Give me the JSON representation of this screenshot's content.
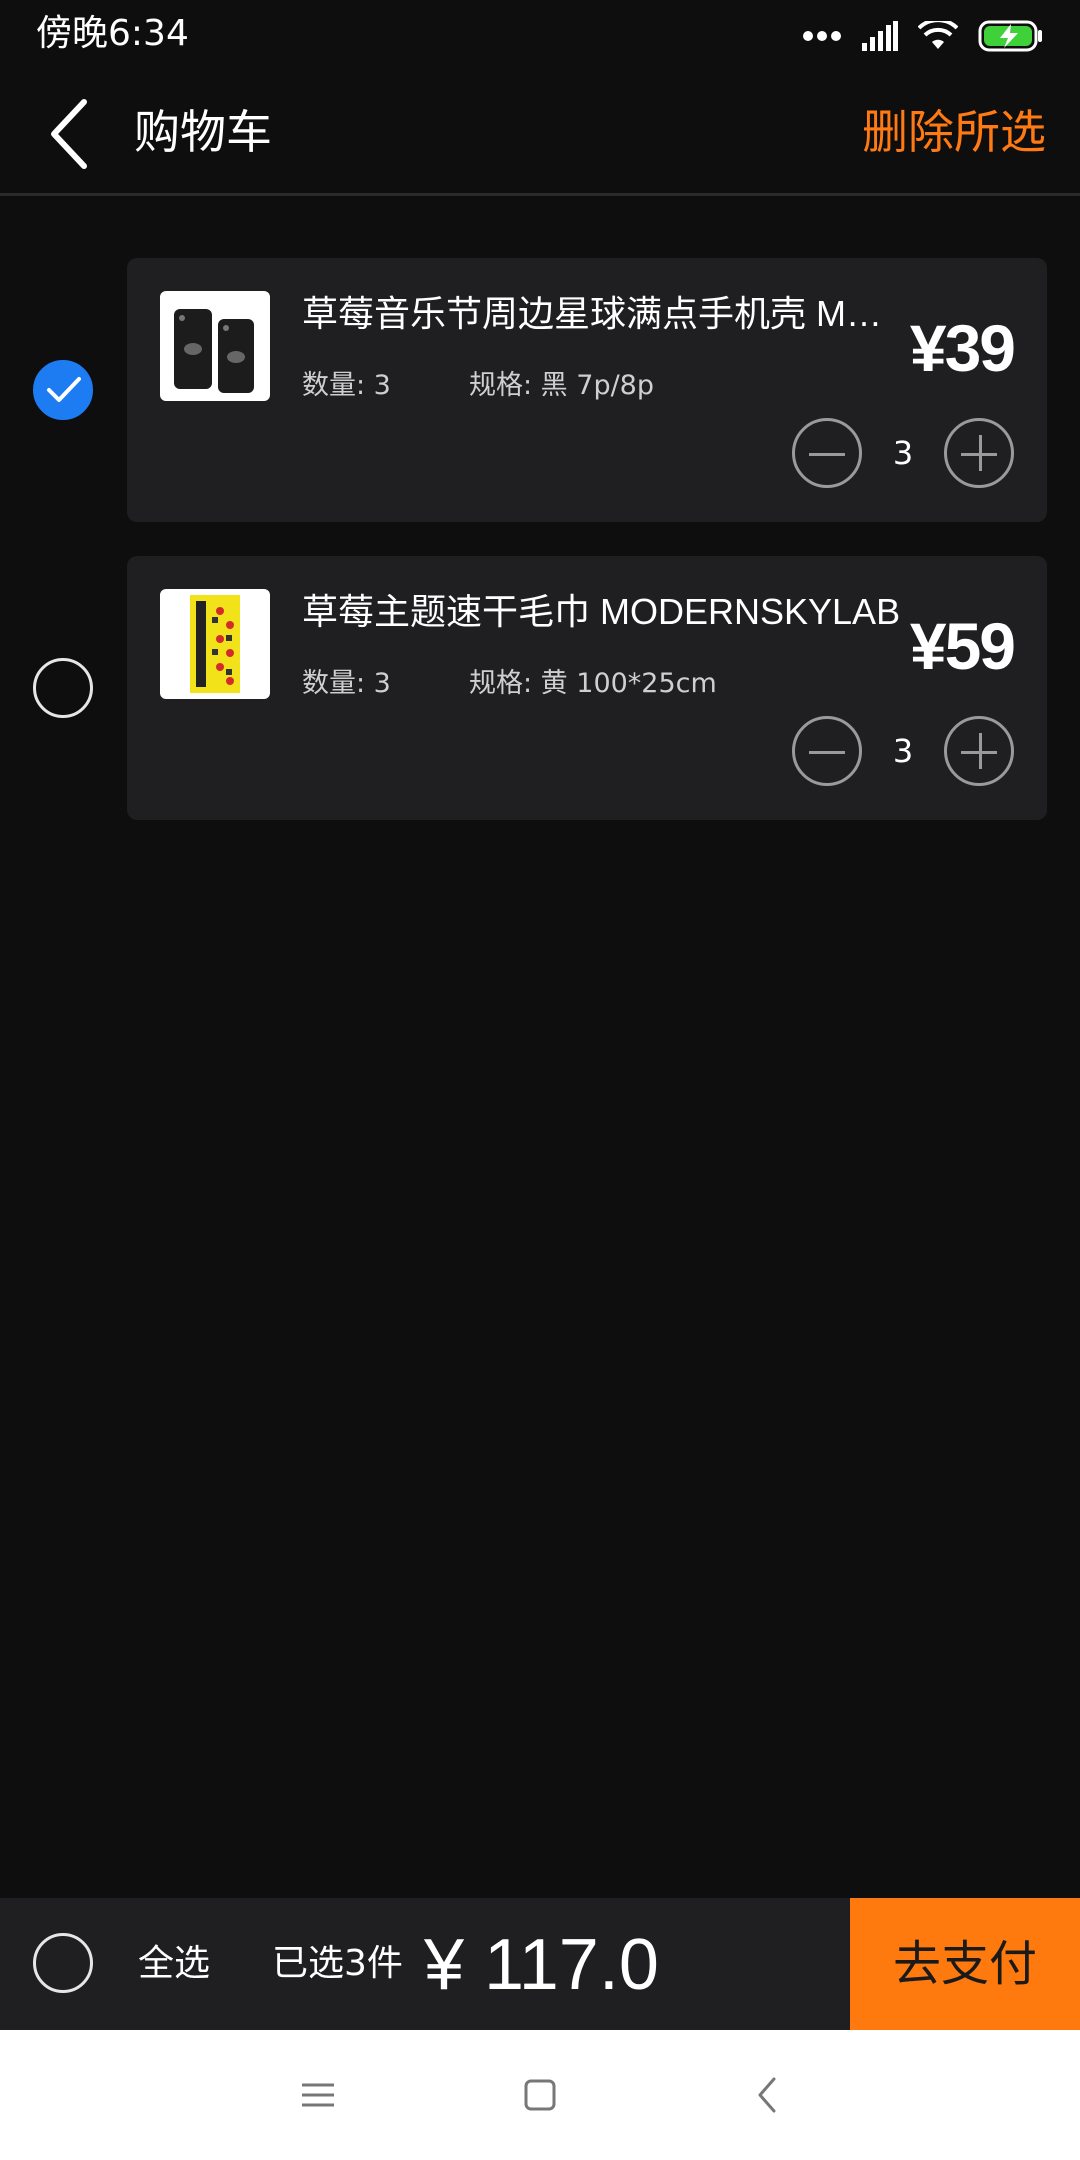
{
  "status_bar": {
    "time": "傍晚6:34"
  },
  "header": {
    "title": "购物车",
    "delete_label": "删除所选"
  },
  "items": [
    {
      "title": "草莓音乐节周边星球满点手机壳 MODERNSKYLAB",
      "quantity_label": "数量: 3",
      "spec_label": "规格: 黑 7p/8p",
      "price": "¥39",
      "quantity": "3",
      "selected": true,
      "thumbnail": "phone-case-thumbnail"
    },
    {
      "title": "草莓主题速干毛巾 MODERNSKYLAB",
      "quantity_label": "数量: 3",
      "spec_label": "规格: 黄 100*25cm",
      "price": "¥59",
      "quantity": "3",
      "selected": false,
      "thumbnail": "towel-thumbnail"
    }
  ],
  "bottom_bar": {
    "select_all_label": "全选",
    "selected_count": "已选3件",
    "total": "¥ 117.0",
    "pay_label": "去支付"
  },
  "colors": {
    "accent": "#ff7a12",
    "checked": "#1e7cf2",
    "card": "#1f1e20",
    "background": "#0e0e0e"
  }
}
